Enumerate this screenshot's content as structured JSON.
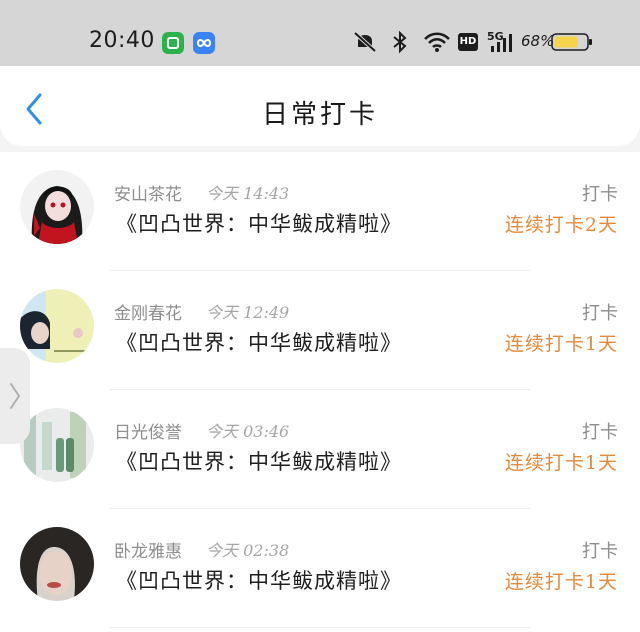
{
  "status_bar": {
    "time": "20:40",
    "battery": "68%",
    "network": "5G",
    "hd": "HD",
    "icons": [
      "wechat-app-icon",
      "infinity-app-icon",
      "silent-bell-icon",
      "bluetooth-icon",
      "wifi-icon",
      "hd-icon",
      "signal-icon",
      "battery-icon"
    ],
    "colors": {
      "wechat": "#2bb24c",
      "infinity": "#3b82f6",
      "battery_fill": "#f5d34a"
    }
  },
  "header": {
    "title": "日常打卡",
    "back_icon": "chevron-left-icon",
    "accent": "#2f8ff0"
  },
  "items": [
    {
      "name": "安山茶花",
      "time": "今天 14:43",
      "book": "《凹凸世界：中华鲅成精啦》",
      "action": "打卡",
      "streak": "连续打卡2天"
    },
    {
      "name": "金刚春花",
      "time": "今天 12:49",
      "book": "《凹凸世界：中华鲅成精啦》",
      "action": "打卡",
      "streak": "连续打卡1天"
    },
    {
      "name": "日光俊誉",
      "time": "今天 03:46",
      "book": "《凹凸世界：中华鲅成精啦》",
      "action": "打卡",
      "streak": "连续打卡1天"
    },
    {
      "name": "卧龙雅惠",
      "time": "今天 02:38",
      "book": "《凹凸世界：中华鲅成精啦》",
      "action": "打卡",
      "streak": "连续打卡1天"
    }
  ],
  "side_handle": {
    "icon": "chevron-right-icon"
  },
  "colors": {
    "streak": "#e58a3c",
    "muted": "#8e8e8e"
  }
}
